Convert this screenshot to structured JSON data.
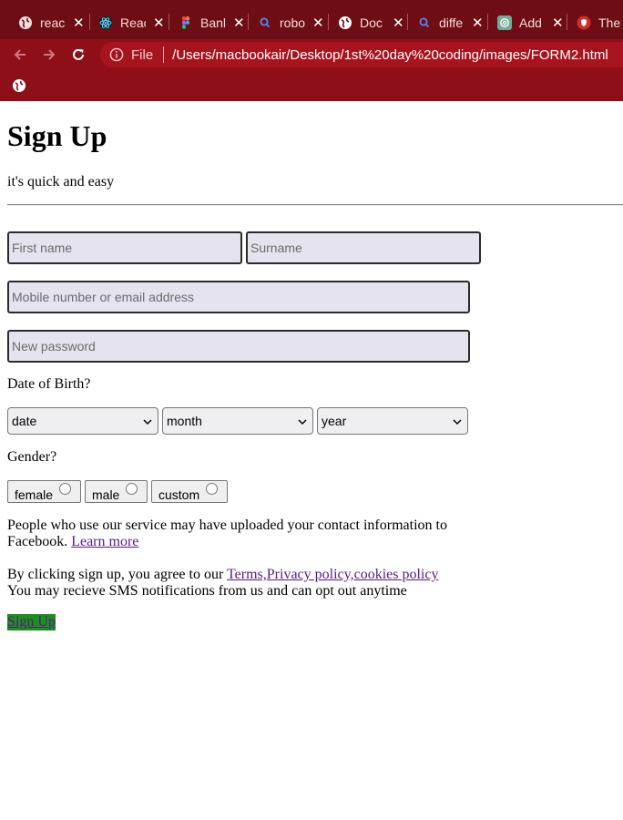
{
  "browser": {
    "tabs": [
      {
        "label": "reac",
        "icon": "globe-icon"
      },
      {
        "label": "Reac",
        "icon": "react-icon"
      },
      {
        "label": "Banl",
        "icon": "figma-icon"
      },
      {
        "label": "robo",
        "icon": "search-icon"
      },
      {
        "label": "Doc",
        "icon": "globe-icon"
      },
      {
        "label": "diffe",
        "icon": "search-icon"
      },
      {
        "label": "Add",
        "icon": "chatgpt-icon"
      },
      {
        "label": "The",
        "icon": "brave-icon"
      }
    ],
    "scheme": "File",
    "url": "/Users/macbookair/Desktop/1st%20day%20coding/images/FORM2.html"
  },
  "page": {
    "title": "Sign Up",
    "tagline": "it's quick and easy",
    "first_name_placeholder": "First name",
    "surname_placeholder": "Surname",
    "contact_placeholder": "Mobile number or email address",
    "password_placeholder": "New password",
    "dob_label": "Date of Birth?",
    "date_select": "date",
    "month_select": "month",
    "year_select": "year",
    "gender_label": "Gender?",
    "gender_options": [
      "female",
      "male",
      "custom"
    ],
    "upload_notice": "People who use our service may have uploaded your contact information to Facebook.",
    "learn_more": "Learn more",
    "terms_prefix": "By clicking sign up, you agree to our",
    "terms_link": "Terms",
    "privacy_link": "Privacy policy",
    "cookies_link": "cookies policy",
    "sms_notice": "You may recieve SMS notifications from us and can opt out anytime",
    "submit_label": "Sign Up"
  },
  "colors": {
    "tab_strip": "#6e0e14",
    "toolbar": "#8e0f18",
    "submit_bg": "#1d8f1d"
  }
}
